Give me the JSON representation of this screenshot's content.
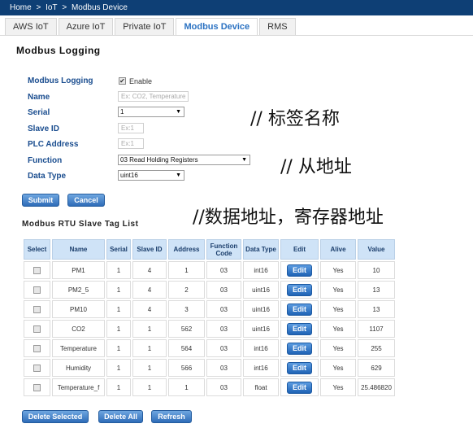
{
  "breadcrumb": [
    "Home",
    ">",
    "IoT",
    ">",
    "Modbus Device"
  ],
  "tabs": [
    {
      "label": "AWS IoT",
      "active": false
    },
    {
      "label": "Azure IoT",
      "active": false
    },
    {
      "label": "Private IoT",
      "active": false
    },
    {
      "label": "Modbus Device",
      "active": true
    },
    {
      "label": "RMS",
      "active": false
    }
  ],
  "section_title": "Modbus Logging",
  "form": {
    "modbus_logging_label": "Modbus Logging",
    "enable_label": "Enable",
    "enable_checked": true,
    "name_label": "Name",
    "name_placeholder": "Ex: CO2, Temperature",
    "serial_label": "Serial",
    "serial_value": "1",
    "slave_id_label": "Slave ID",
    "slave_id_placeholder": "Ex:1",
    "plc_address_label": "PLC Address",
    "plc_address_placeholder": "Ex:1",
    "function_label": "Function",
    "function_value": "03 Read Holding Registers",
    "data_type_label": "Data Type",
    "data_type_value": "uint16"
  },
  "buttons": {
    "submit": "Submit",
    "cancel": "Cancel",
    "delete_selected": "Delete Selected",
    "delete_all": "Delete All",
    "refresh": "Refresh"
  },
  "annotations": {
    "tag_name": "// 标签名称",
    "slave_address": "// 从地址",
    "data_address": "//数据地址，寄存器地址"
  },
  "list_title": "Modbus RTU Slave Tag List",
  "table": {
    "headers": [
      "Select",
      "Name",
      "Serial",
      "Slave ID",
      "Address",
      "Function Code",
      "Data Type",
      "Edit",
      "Alive",
      "Value"
    ],
    "edit_label": "Edit",
    "rows": [
      {
        "name": "PM1",
        "serial": "1",
        "slave_id": "4",
        "address": "1",
        "function": "03",
        "data_type": "int16",
        "alive": "Yes",
        "value": "10"
      },
      {
        "name": "PM2_5",
        "serial": "1",
        "slave_id": "4",
        "address": "2",
        "function": "03",
        "data_type": "uint16",
        "alive": "Yes",
        "value": "13"
      },
      {
        "name": "PM10",
        "serial": "1",
        "slave_id": "4",
        "address": "3",
        "function": "03",
        "data_type": "uint16",
        "alive": "Yes",
        "value": "13"
      },
      {
        "name": "CO2",
        "serial": "1",
        "slave_id": "1",
        "address": "562",
        "function": "03",
        "data_type": "uint16",
        "alive": "Yes",
        "value": "1107"
      },
      {
        "name": "Temperature",
        "serial": "1",
        "slave_id": "1",
        "address": "564",
        "function": "03",
        "data_type": "int16",
        "alive": "Yes",
        "value": "255"
      },
      {
        "name": "Humidity",
        "serial": "1",
        "slave_id": "1",
        "address": "566",
        "function": "03",
        "data_type": "int16",
        "alive": "Yes",
        "value": "629"
      },
      {
        "name": "Temperature_f",
        "serial": "1",
        "slave_id": "1",
        "address": "1",
        "function": "03",
        "data_type": "float",
        "alive": "Yes",
        "value": "25.486820"
      }
    ]
  },
  "icons": {
    "dropdown": "chevron-down-icon",
    "checkbox": "checkbox-icon"
  },
  "colors": {
    "header_bg": "#0e3f75",
    "accent": "#2b72c2",
    "button": "#2e6cb8",
    "table_header": "#cfe3f7",
    "label": "#1a4d8f"
  }
}
